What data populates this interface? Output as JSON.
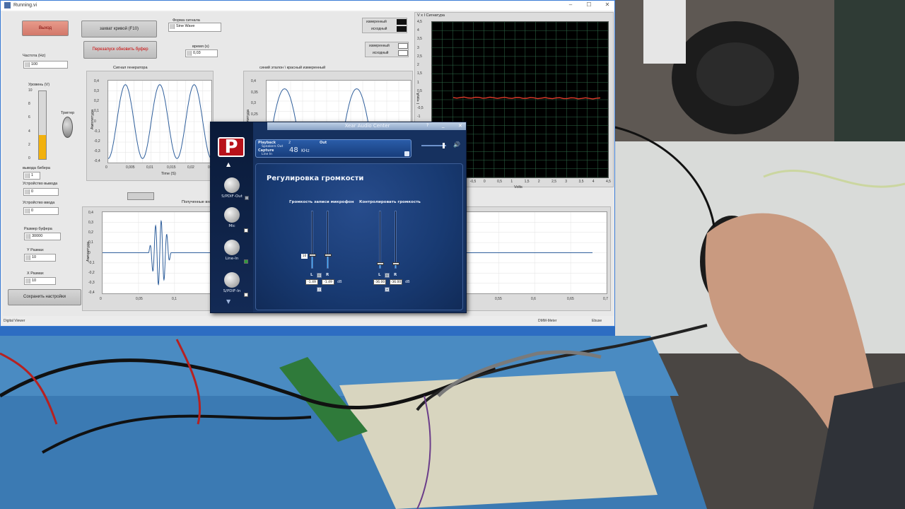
{
  "labview": {
    "window_title": "Running.vi",
    "buttons": {
      "exit": "Выход",
      "capture": "захват кривой (F10)",
      "restart": "Перезапуск обновить буфер",
      "save": "Сохранить настройки"
    },
    "signal_form_label": "Форма сигнала",
    "signal_form_value": "Sine Wave",
    "time_label": "время (s)",
    "time_value": "0,03",
    "frequency_label": "Частота (Hz)",
    "frequency_value": "100",
    "level_label": "Уровень (V)",
    "level_ticks": [
      "10",
      "8",
      "6",
      "4",
      "2",
      "0"
    ],
    "level_fraction": 0.35,
    "trigger_label": "Триггер",
    "buffer_out_label": "вывода бибера",
    "buffer_out_value": "1",
    "device_out_label": "Устройство вывода",
    "device_out_value": "0",
    "device_in_label": "Устройство ввода",
    "device_in_value": "0",
    "buffer_size_label": "Размер буфера",
    "buffer_size_value": "30000",
    "y_range_label": "Y Размах",
    "y_range_value": "10",
    "x_range_label": "X Размах",
    "x_range_value": "10",
    "graph_generator": {
      "title": "Сигнал генератора",
      "ylabel": "Амплитуда",
      "xlabel": "Time (S)",
      "y_ticks": [
        "0,4",
        "0,3",
        "0,2",
        "0,1",
        "0",
        "-0,1",
        "-0,2",
        "-0,3",
        "-0,4"
      ],
      "x_ticks": [
        "0",
        "0,005",
        "0,01",
        "0,015",
        "0,02",
        "0,025"
      ]
    },
    "graph_reference": {
      "title": "синий эталон \\ красный измеренный",
      "ylabel": "Амплитуда",
      "y_ticks": [
        "0,4",
        "0,35",
        "0,3",
        "0,25",
        "0,2",
        "0,15",
        "0,1",
        "0,05"
      ]
    },
    "legend_top": {
      "measured": "измеренный",
      "source": "исходный"
    },
    "legend_mid": {
      "measured": "измеренный",
      "source": "исходный"
    },
    "graph_received": {
      "title": "Полученные входы",
      "ylabel": "Амплитуда",
      "y_ticks": [
        "0,4",
        "0,3",
        "0,2",
        "0,1",
        "0",
        "-0,1",
        "-0,2",
        "-0,3",
        "-0,4"
      ],
      "x_ticks_left": [
        "0",
        "0,05",
        "0,1"
      ],
      "x_ticks_right": [
        "0,55",
        "0,6",
        "0,65",
        "0,7"
      ]
    },
    "xy_graph": {
      "title": "V x I Сигнатура",
      "ylabel": "I = mA",
      "xlabel": "Volts",
      "y_ticks": [
        "4,5",
        "4",
        "3,5",
        "3",
        "2,5",
        "2",
        "1,5",
        "1",
        "0,5",
        "0",
        "-0,5",
        "-1",
        "-1,5",
        "-2",
        "-2,5",
        "-3",
        "-3,5",
        "-4",
        "-4,5"
      ],
      "x_ticks": [
        "-2",
        "-1,5",
        "-1",
        "-0,5",
        "0",
        "0,5",
        "1",
        "1,5",
        "2",
        "2,5",
        "3",
        "3,5",
        "4",
        "4,5"
      ]
    },
    "status": {
      "left": "Digital Viewer",
      "right1": "DMM-Meter",
      "right2": "Ebuse"
    }
  },
  "xear": {
    "title": "Xear Audio Center",
    "header": {
      "playback_label": "Playback",
      "speakers_out": "Speakers Out",
      "capture_label": "Capture",
      "line_in": "Line In",
      "channels": "2",
      "rate": "48",
      "rate_unit": "KHz",
      "out_label": "Out"
    },
    "sidebar": [
      {
        "label": "S/PDIF-Out",
        "checked": false
      },
      {
        "label": "Mic",
        "checked": false
      },
      {
        "label": "Line-In",
        "checked": true
      },
      {
        "label": "S/PDIF-In",
        "checked": false
      }
    ],
    "panel_title": "Регулировка громкости",
    "record_group_label": "Громкость записи микрофон",
    "monitor_group_label": "Контролировать громкость",
    "record": {
      "left_label": "L",
      "right_label": "R",
      "left_value": "-1.49",
      "right_value": "-1.49",
      "level_fraction": 0.25,
      "marker": "10",
      "unit": "dB"
    },
    "monitor": {
      "left_label": "L",
      "right_label": "R",
      "left_value": "-36.00",
      "right_value": "-36.00",
      "level_fraction": 0.1,
      "unit": "dB"
    },
    "colors": {
      "logo_red": "#b8121a",
      "accent_blue": "#3fb0ff"
    }
  }
}
